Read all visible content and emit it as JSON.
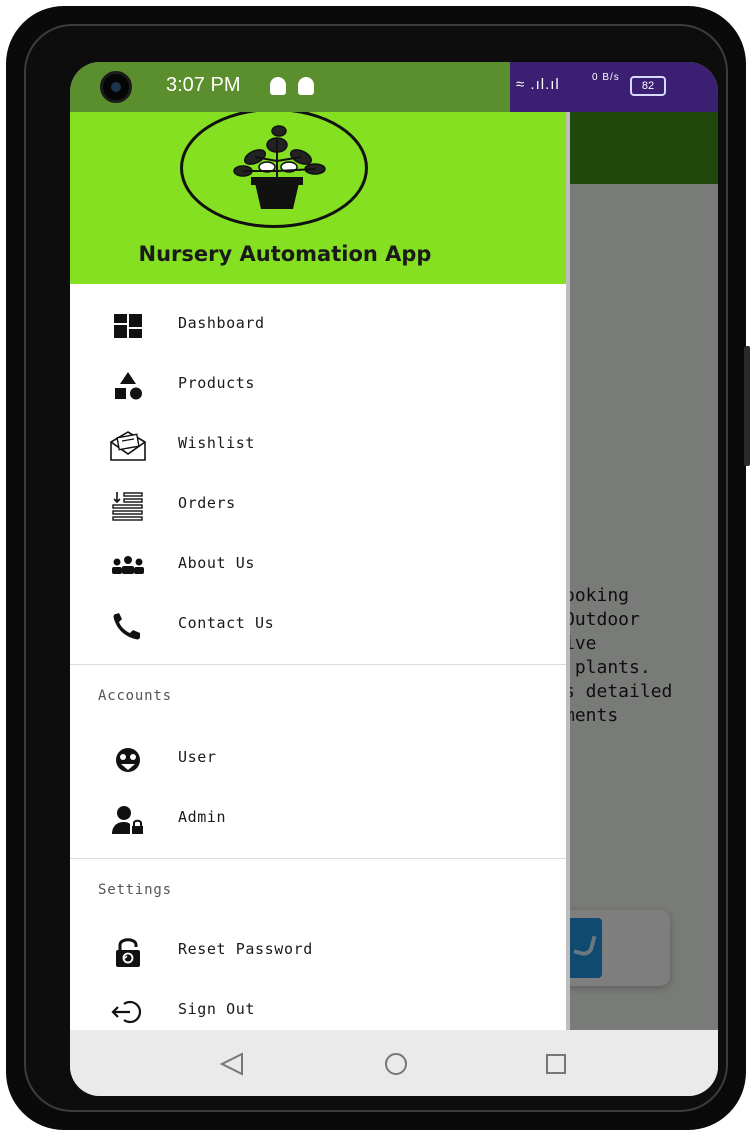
{
  "status_bar": {
    "time": "3:07 PM",
    "network_icons": "≈ .ıl.ıl",
    "data_rate": "0 B/s",
    "battery": "82"
  },
  "drawer": {
    "app_title": "Nursery Automation App",
    "items": [
      {
        "label": "Dashboard",
        "icon": "dashboard-icon"
      },
      {
        "label": "Products",
        "icon": "category-icon"
      },
      {
        "label": "Wishlist",
        "icon": "mail-icon"
      },
      {
        "label": "Orders",
        "icon": "orders-list-icon"
      },
      {
        "label": "About Us",
        "icon": "group-icon"
      },
      {
        "label": "Contact Us",
        "icon": "phone-icon"
      }
    ],
    "accounts": {
      "title": "Accounts",
      "items": [
        {
          "label": "User",
          "icon": "user-face-icon"
        },
        {
          "label": "Admin",
          "icon": "admin-lock-icon"
        }
      ]
    },
    "settings": {
      "title": "Settings",
      "items": [
        {
          "label": "Reset Password",
          "icon": "unlock-icon"
        },
        {
          "label": "Sign Out",
          "icon": "sign-out-icon"
        }
      ]
    }
  },
  "background": {
    "visible_text": "ooking\nOutdoor\nive\n plants.\ns detailed\nments"
  },
  "nav_bar": {
    "back": "back-triangle-icon",
    "home": "home-circle-icon",
    "recents": "recents-square-icon"
  },
  "colors": {
    "drawer_header": "#84e021",
    "status_bar": "#5b8f2e"
  }
}
